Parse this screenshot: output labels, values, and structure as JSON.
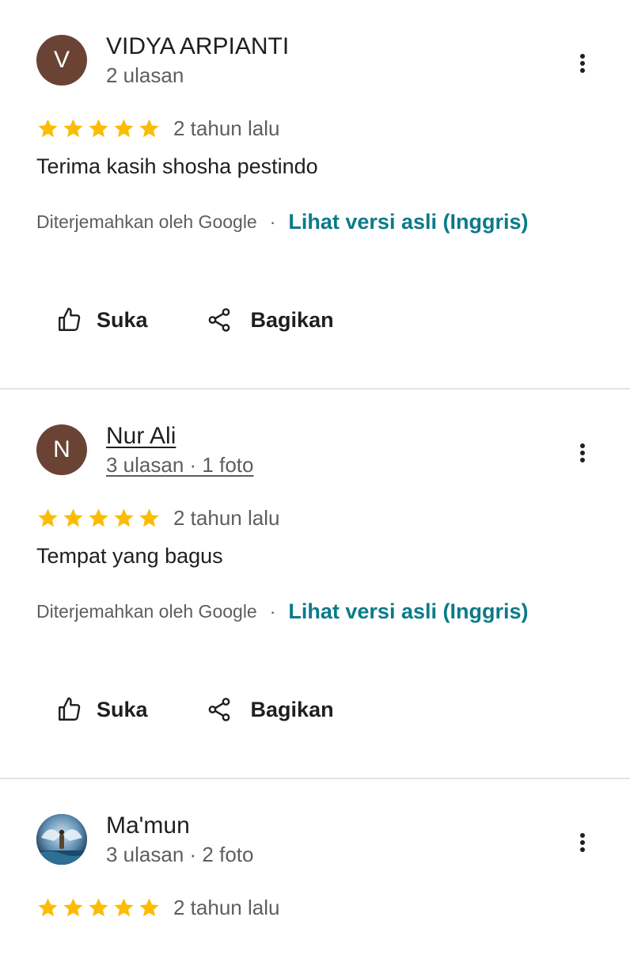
{
  "colors": {
    "star": "#fbbc04",
    "link": "#0b7a8a",
    "avatar_brown": "#6b4335",
    "divider": "#e3e3e3"
  },
  "reviews": [
    {
      "avatar_letter": "V",
      "name": "VIDYA ARPIANTI",
      "meta": "2 ulasan",
      "rating": 5,
      "date": "2 tahun lalu",
      "text": "Terima kasih shosha pestindo",
      "translated_by": "Diterjemahkan oleh Google",
      "separator": "·",
      "original_link": "Lihat versi asli (Inggris)",
      "like_label": "Suka",
      "share_label": "Bagikan"
    },
    {
      "avatar_letter": "N",
      "name": "Nur Ali",
      "meta": "3 ulasan · 1 foto",
      "rating": 5,
      "date": "2 tahun lalu",
      "text": "Tempat yang bagus",
      "translated_by": "Diterjemahkan oleh Google",
      "separator": "·",
      "original_link": "Lihat versi asli (Inggris)",
      "like_label": "Suka",
      "share_label": "Bagikan"
    },
    {
      "avatar_icon": "profile-photo",
      "name": "Ma'mun",
      "meta": "3 ulasan · 2 foto",
      "rating": 5,
      "date": "2 tahun lalu"
    }
  ],
  "icons": {
    "more": "more-vert-icon",
    "star": "star-icon",
    "like": "thumb-up-icon",
    "share": "share-icon"
  }
}
